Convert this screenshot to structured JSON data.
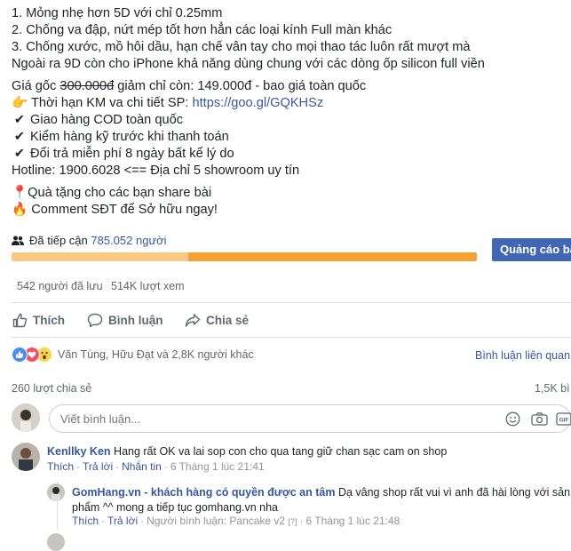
{
  "post": {
    "lines": [
      {
        "text": "1. Mỏng nhẹ hơn 5D với chỉ 0.25mm"
      },
      {
        "text": "2. Chống va đập, nứt mép tốt hơn hẳn các loại kính Full màn khác"
      },
      {
        "text": "3. Chống xước, mồ hôi dầu, hạn chế vân tay cho mọi thao tác luôn rất mượt mà"
      },
      {
        "text": "Ngoài ra 9D còn cho iPhone khả năng dùng chung với các dòng ốp silicon full viền"
      }
    ],
    "price": {
      "prefix": "Giá gốc ",
      "old": "300.000đ",
      "suffix": " giảm chỉ còn: 149.000đ - bao giá toàn quốc"
    },
    "promo": {
      "icon": "👉",
      "text": " Thời hạn KM va chi tiết SP: ",
      "link": "https://goo.gl/GQKHSz"
    },
    "checks": [
      {
        "icon": "✔",
        "text": "Giao hàng COD toàn quốc"
      },
      {
        "icon": "✔",
        "text": "Kiểm hàng kỹ trước khi thanh toán"
      },
      {
        "icon": "✔",
        "text": "Đổi trả miễn phí 8 ngày bất kể lý do"
      }
    ],
    "hotline": "Hotline: 1900.6028 <== Địa chỉ 5 showroom uy tín",
    "gift": {
      "icon": "📍",
      "text": "Quà tặng cho các bạn share bài"
    },
    "comment_cta": {
      "icon": "🔥",
      "text": " Comment SĐT để Sở hữu ngay!"
    }
  },
  "reach": {
    "label": "Đã tiếp cận ",
    "count": "785.052 người",
    "progress_fraction": 0.38,
    "colors": {
      "organic": "#f8c983",
      "paid": "#f4a236"
    },
    "promote_label": "Quảng cáo bà"
  },
  "stats": {
    "saves": "542 người đã lưu",
    "views": "514K lượt xem"
  },
  "actions": {
    "like": "Thích",
    "comment": "Bình luận",
    "share": "Chia sẻ"
  },
  "reactions": {
    "names": "Văn Tùng, Hữu Đạt và 2,8K người khác",
    "relevant": "Bình luận liên quan",
    "shares": "260 lượt chia sẻ",
    "comments_count": "1,5K bì"
  },
  "comment_input": {
    "placeholder": "Viết bình luận..."
  },
  "comments": [
    {
      "author": "Kenllky Ken",
      "text": " Hang rất OK va lai sop con cho qua tang giữ chan sạc cam on shop",
      "actions": [
        "Thích",
        "Trả lời",
        "Nhắn tin"
      ],
      "time": "6 Tháng 1 lúc 21:41"
    }
  ],
  "reply": {
    "author": "GomHang.vn - khách hàng có quyền được an tâm",
    "text_line1": " Dạ vâng shop rất vui vì anh đã hài lòng với sản",
    "text_line2": "phẩm ^^ mong a tiếp tục gomhang.vn nha",
    "actions": [
      "Thích",
      "Trả lời"
    ],
    "by": "Người bình luận: Pancake v2",
    "badge": "[?]",
    "time": "6 Tháng 1 lúc 21:48"
  }
}
